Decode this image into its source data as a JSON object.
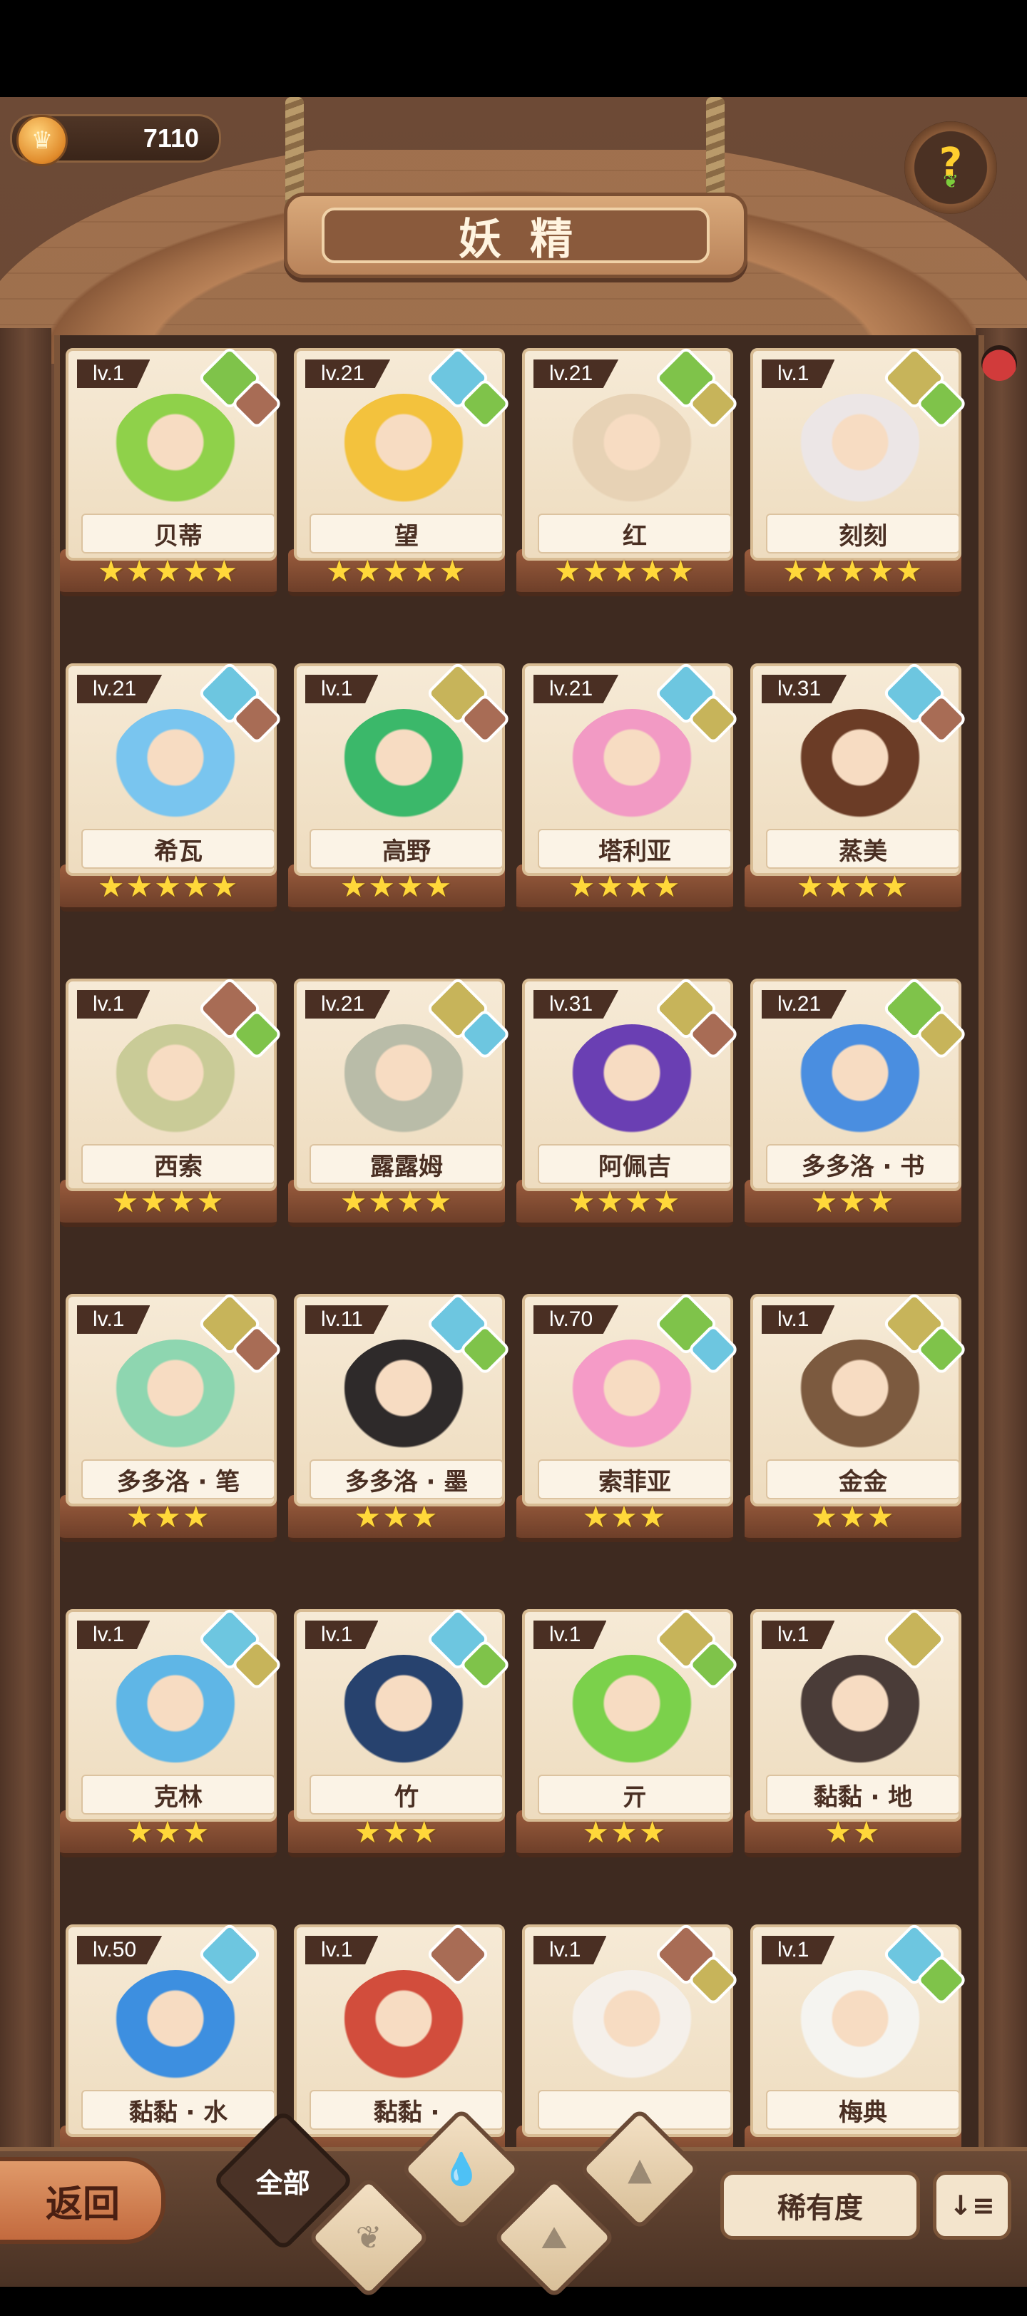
{
  "header": {
    "coins": "7110",
    "title": "妖精",
    "help_label": "?"
  },
  "fairies": [
    {
      "name": "贝蒂",
      "level": "lv.1",
      "stars": 5,
      "element": "green",
      "sub": "rock",
      "color": "#8fd14a"
    },
    {
      "name": "望",
      "level": "lv.21",
      "stars": 5,
      "element": "blue",
      "sub": "green",
      "color": "#f3c23d"
    },
    {
      "name": "红",
      "level": "lv.21",
      "stars": 5,
      "element": "green",
      "sub": "gold",
      "color": "#e7d2b5"
    },
    {
      "name": "刻刻",
      "level": "lv.1",
      "stars": 5,
      "element": "gold",
      "sub": "green",
      "color": "#ece6e6"
    },
    {
      "name": "希瓦",
      "level": "lv.21",
      "stars": 5,
      "element": "blue",
      "sub": "rock",
      "color": "#79c5ef"
    },
    {
      "name": "高野",
      "level": "lv.1",
      "stars": 4,
      "element": "gold",
      "sub": "rock",
      "color": "#3bb86a"
    },
    {
      "name": "塔利亚",
      "level": "lv.21",
      "stars": 4,
      "element": "blue",
      "sub": "gold",
      "color": "#f29ac4"
    },
    {
      "name": "蒸美",
      "level": "lv.31",
      "stars": 4,
      "element": "blue",
      "sub": "rock",
      "color": "#6b3c26"
    },
    {
      "name": "西索",
      "level": "lv.1",
      "stars": 4,
      "element": "rock",
      "sub": "green",
      "color": "#c9cb97"
    },
    {
      "name": "露露姆",
      "level": "lv.21",
      "stars": 4,
      "element": "gold",
      "sub": "blue",
      "color": "#b9bca8"
    },
    {
      "name": "阿佩吉",
      "level": "lv.31",
      "stars": 4,
      "element": "gold",
      "sub": "rock",
      "color": "#6a3fb3"
    },
    {
      "name": "多多洛 · 书",
      "level": "lv.21",
      "stars": 3,
      "element": "green",
      "sub": "gold",
      "color": "#4a8ee0"
    },
    {
      "name": "多多洛 · 笔",
      "level": "lv.1",
      "stars": 3,
      "element": "gold",
      "sub": "rock",
      "color": "#8ed6b0"
    },
    {
      "name": "多多洛 · 墨",
      "level": "lv.11",
      "stars": 3,
      "element": "blue",
      "sub": "green",
      "color": "#2e2a2a"
    },
    {
      "name": "索菲亚",
      "level": "lv.70",
      "stars": 3,
      "element": "green",
      "sub": "blue",
      "color": "#f59bc7"
    },
    {
      "name": "金金",
      "level": "lv.1",
      "stars": 3,
      "element": "gold",
      "sub": "green",
      "color": "#7c5a3f"
    },
    {
      "name": "克林",
      "level": "lv.1",
      "stars": 3,
      "element": "blue",
      "sub": "gold",
      "color": "#5fb6e6"
    },
    {
      "name": "竹",
      "level": "lv.1",
      "stars": 3,
      "element": "blue",
      "sub": "green",
      "color": "#27426e"
    },
    {
      "name": "亓",
      "level": "lv.1",
      "stars": 3,
      "element": "gold",
      "sub": "green",
      "color": "#7bd14b"
    },
    {
      "name": "黏黏 · 地",
      "level": "lv.1",
      "stars": 2,
      "element": "gold",
      "sub": "",
      "color": "#4a3c38"
    },
    {
      "name": "黏黏 · 水",
      "level": "lv.50",
      "stars": 0,
      "element": "blue",
      "sub": "",
      "color": "#3d8fe0"
    },
    {
      "name": "黏黏 ·",
      "level": "lv.1",
      "stars": 0,
      "element": "rock",
      "sub": "",
      "color": "#d24d3c"
    },
    {
      "name": "",
      "level": "lv.1",
      "stars": 0,
      "element": "rock",
      "sub": "gold",
      "color": "#f5f0ea"
    },
    {
      "name": "梅典",
      "level": "lv.1",
      "stars": 0,
      "element": "blue",
      "sub": "green",
      "color": "#f5f4f0"
    }
  ],
  "bottom": {
    "back_label": "返回",
    "filter_all": "全部",
    "rarity_label": "稀有度",
    "sort_label": "↓≡"
  }
}
